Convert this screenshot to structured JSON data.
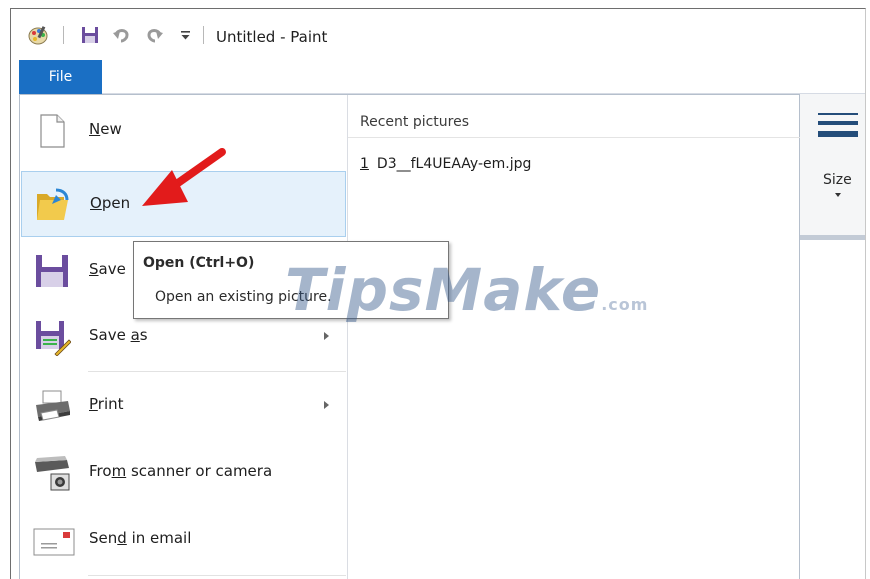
{
  "window": {
    "title": "Untitled - Paint"
  },
  "tabs": {
    "file": "File"
  },
  "ribbon": {
    "size_label": "Size"
  },
  "menu": {
    "items": [
      {
        "label": "New",
        "key": "N",
        "rest": "ew"
      },
      {
        "label": "Open",
        "key": "O",
        "rest": "pen"
      },
      {
        "label": "Save",
        "key": "S",
        "rest": "ave"
      },
      {
        "label": "Save as",
        "pre": "Save ",
        "key": "a",
        "rest": "s"
      },
      {
        "label": "Print",
        "key": "P",
        "rest": "rint"
      },
      {
        "label": "From scanner or camera",
        "pre": "Fro",
        "key": "m",
        "rest": " scanner or camera"
      },
      {
        "label": "Send in email",
        "pre": "Sen",
        "key": "d",
        "rest": " in email"
      }
    ]
  },
  "recent": {
    "header": "Recent pictures",
    "items": [
      {
        "number": "1",
        "name": "D3__fL4UEAAy-em.jpg"
      }
    ]
  },
  "tooltip": {
    "title": "Open (Ctrl+O)",
    "description": "Open an existing picture."
  },
  "watermark": {
    "main": "TipsMake",
    "suffix": ".com"
  },
  "colors": {
    "file_tab": "#1a6fc4",
    "hover": "#e5f1fb",
    "arrow": "#e21b1b"
  },
  "icons": [
    "paint-app-icon",
    "save-icon",
    "undo-icon",
    "redo-icon",
    "customize-qat-icon",
    "new-file-icon",
    "open-folder-icon",
    "save-disk-icon",
    "save-as-icon",
    "printer-icon",
    "scanner-icon",
    "email-icon"
  ]
}
